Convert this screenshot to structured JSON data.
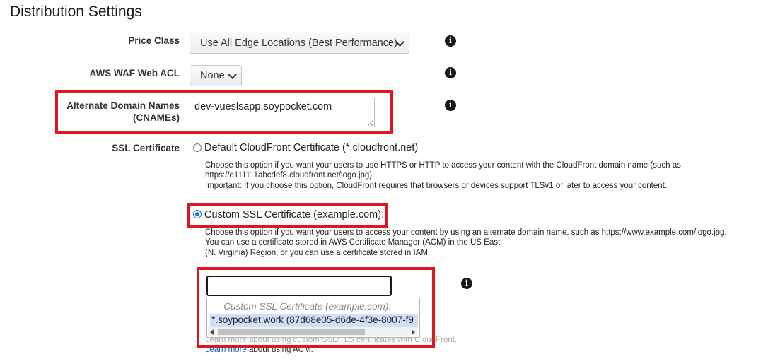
{
  "section_title": "Distribution Settings",
  "price_class": {
    "label": "Price Class",
    "value": "Use All Edge Locations (Best Performance)"
  },
  "waf": {
    "label": "AWS WAF Web ACL",
    "value": "None"
  },
  "cnames": {
    "label_line1": "Alternate Domain Names",
    "label_line2": "(CNAMEs)",
    "value": "dev-vueslsapp.soypocket.com"
  },
  "ssl": {
    "label": "SSL Certificate",
    "default_option": {
      "label": "Default CloudFront Certificate (*.cloudfront.net)",
      "help_line1": "Choose this option if you want your users to use HTTPS or HTTP to access your content with the CloudFront domain name (such as",
      "help_line2": "https://d111111abcdef8.cloudfront.net/logo.jpg).",
      "help_line3": "Important: If you choose this option, CloudFront requires that browsers or devices support TLSv1 or later to access your content."
    },
    "custom_option": {
      "label": "Custom SSL Certificate (example.com):",
      "help_line1": "Choose this option if you want your users to access your content by using an alternate domain name, such as https://www.example.com/logo.jpg.",
      "help_line2": "You can use a certificate stored in AWS Certificate Manager (ACM) in the US East",
      "help_line3": "(N. Virginia) Region, or you can use a certificate stored in IAM."
    },
    "cert_input_value": "",
    "dropdown": {
      "group_label": "— Custom SSL Certificate (example.com): —",
      "option": "*.soypocket.work (87d68e05-d6de-4f3e-8007-f9"
    },
    "learn_more_1": {
      "link": "Learn more",
      "text": " about using custom SSL/TLS certificates with CloudFront."
    },
    "learn_more_2": {
      "link": "Learn more",
      "text": " about using ACM."
    }
  },
  "colors": {
    "highlight_border": "#e0161e",
    "link": "#0066c0",
    "radio_accent": "#1a73e8"
  }
}
